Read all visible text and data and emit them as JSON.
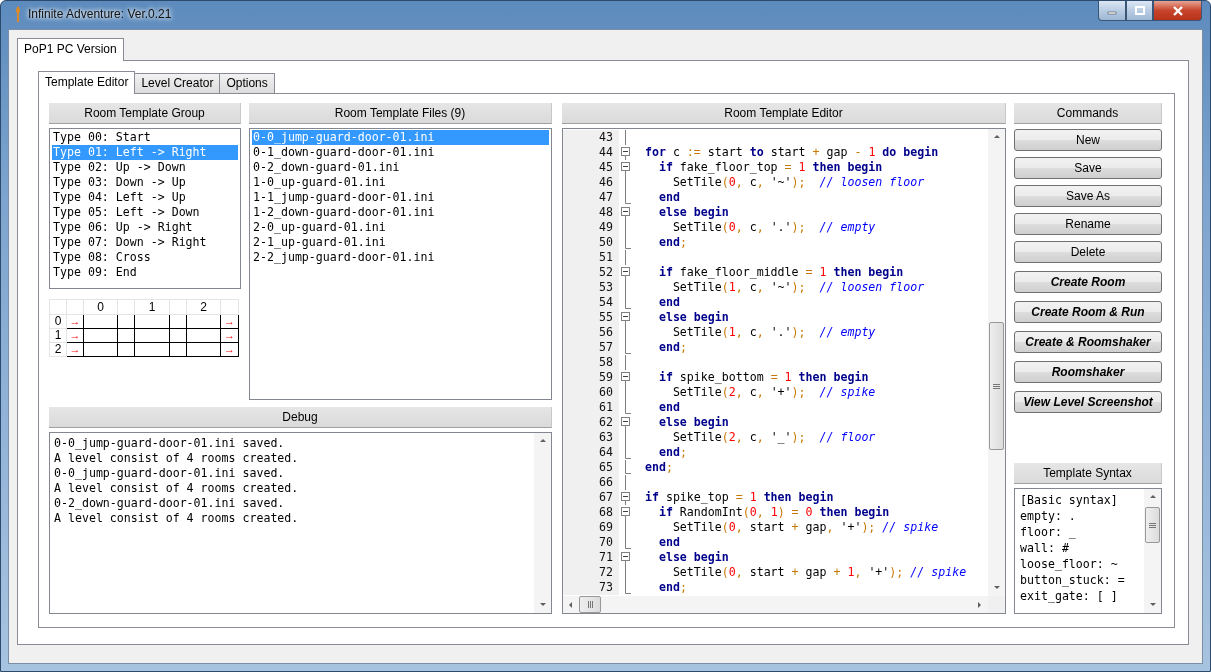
{
  "window": {
    "title": "Infinite Adventure: Ver.0.21"
  },
  "outer_tabs": [
    {
      "label": "PoP1 PC Version",
      "selected": true
    }
  ],
  "inner_tabs": [
    {
      "label": "Template Editor",
      "selected": true
    },
    {
      "label": "Level Creator",
      "selected": false
    },
    {
      "label": "Options",
      "selected": false
    }
  ],
  "room_template_group": {
    "title": "Room Template Group",
    "items": [
      {
        "label": "Type 00: Start",
        "selected": false
      },
      {
        "label": "Type 01: Left -> Right",
        "selected": true
      },
      {
        "label": "Type 02: Up -> Down",
        "selected": false
      },
      {
        "label": "Type 03: Down -> Up",
        "selected": false
      },
      {
        "label": "Type 04: Left -> Up",
        "selected": false
      },
      {
        "label": "Type 05: Left -> Down",
        "selected": false
      },
      {
        "label": "Type 06: Up -> Right",
        "selected": false
      },
      {
        "label": "Type 07: Down -> Right",
        "selected": false
      },
      {
        "label": "Type 08: Cross",
        "selected": false
      },
      {
        "label": "Type 09: End",
        "selected": false
      }
    ]
  },
  "room_grid": {
    "columns": [
      "0",
      "1",
      "2"
    ],
    "rows": [
      {
        "label": "0",
        "left": "→",
        "right": "→"
      },
      {
        "label": "1",
        "left": "→",
        "right": "→"
      },
      {
        "label": "2",
        "left": "→",
        "right": "→"
      }
    ]
  },
  "room_template_files": {
    "title": "Room Template Files (9)",
    "items": [
      {
        "label": "0-0_jump-guard-door-01.ini",
        "selected": true
      },
      {
        "label": "0-1_down-guard-door-01.ini",
        "selected": false
      },
      {
        "label": "0-2_down-guard-01.ini",
        "selected": false
      },
      {
        "label": "1-0_up-guard-01.ini",
        "selected": false
      },
      {
        "label": "1-1_jump-guard-door-01.ini",
        "selected": false
      },
      {
        "label": "1-2_down-guard-door-01.ini",
        "selected": false
      },
      {
        "label": "2-0_up-guard-01.ini",
        "selected": false
      },
      {
        "label": "2-1_up-guard-01.ini",
        "selected": false
      },
      {
        "label": "2-2_jump-guard-door-01.ini",
        "selected": false
      }
    ]
  },
  "debug": {
    "title": "Debug",
    "lines": [
      "0-0_jump-guard-door-01.ini saved.",
      "A level consist of 4 rooms created.",
      "0-0_jump-guard-door-01.ini saved.",
      "A level consist of 4 rooms created.",
      "0-2_down-guard-door-01.ini saved.",
      "A level consist of 4 rooms created."
    ]
  },
  "editor": {
    "title": "Room Template Editor",
    "lines": [
      {
        "number": "43",
        "kind": "line"
      },
      {
        "number": "44",
        "kind": "open",
        "tokens": [
          {
            "kind": "keyword",
            "text": "  for"
          },
          {
            "kind": "plain",
            "text": " c "
          },
          {
            "kind": "symbol",
            "text": ":="
          },
          {
            "kind": "plain",
            "text": " start "
          },
          {
            "kind": "keyword",
            "text": "to"
          },
          {
            "kind": "plain",
            "text": " start "
          },
          {
            "kind": "symbol",
            "text": "+"
          },
          {
            "kind": "plain",
            "text": " gap "
          },
          {
            "kind": "symbol",
            "text": "- "
          },
          {
            "kind": "number",
            "text": "1"
          },
          {
            "kind": "keyword",
            "text": " do begin"
          }
        ]
      },
      {
        "number": "45",
        "kind": "open",
        "tokens": [
          {
            "kind": "keyword",
            "text": "    if"
          },
          {
            "kind": "plain",
            "text": " fake_floor_top "
          },
          {
            "kind": "symbol",
            "text": "= "
          },
          {
            "kind": "number",
            "text": "1"
          },
          {
            "kind": "keyword",
            "text": " then begin"
          }
        ]
      },
      {
        "number": "46",
        "kind": "line",
        "tokens": [
          {
            "kind": "plain",
            "text": "      SetTile"
          },
          {
            "kind": "symbol",
            "text": "("
          },
          {
            "kind": "number",
            "text": "0"
          },
          {
            "kind": "symbol",
            "text": ","
          },
          {
            "kind": "plain",
            "text": " c"
          },
          {
            "kind": "symbol",
            "text": ","
          },
          {
            "kind": "plain",
            "text": " '~'"
          },
          {
            "kind": "symbol",
            "text": ");  "
          },
          {
            "kind": "comment",
            "text": "// loosen floor"
          }
        ]
      },
      {
        "number": "47",
        "kind": "end",
        "tokens": [
          {
            "kind": "keyword",
            "text": "    end"
          }
        ]
      },
      {
        "number": "48",
        "kind": "open",
        "tokens": [
          {
            "kind": "keyword",
            "text": "    else begin"
          }
        ]
      },
      {
        "number": "49",
        "kind": "line",
        "tokens": [
          {
            "kind": "plain",
            "text": "      SetTile"
          },
          {
            "kind": "symbol",
            "text": "("
          },
          {
            "kind": "number",
            "text": "0"
          },
          {
            "kind": "symbol",
            "text": ","
          },
          {
            "kind": "plain",
            "text": " c"
          },
          {
            "kind": "symbol",
            "text": ","
          },
          {
            "kind": "plain",
            "text": " '.'"
          },
          {
            "kind": "symbol",
            "text": ");  "
          },
          {
            "kind": "comment",
            "text": "// empty"
          }
        ]
      },
      {
        "number": "50",
        "kind": "end",
        "tokens": [
          {
            "kind": "keyword",
            "text": "    end"
          },
          {
            "kind": "symbol",
            "text": ";"
          }
        ]
      },
      {
        "number": "51",
        "kind": "line"
      },
      {
        "number": "52",
        "kind": "open",
        "tokens": [
          {
            "kind": "keyword",
            "text": "    if"
          },
          {
            "kind": "plain",
            "text": " fake_floor_middle "
          },
          {
            "kind": "symbol",
            "text": "= "
          },
          {
            "kind": "number",
            "text": "1"
          },
          {
            "kind": "keyword",
            "text": " then begin"
          }
        ]
      },
      {
        "number": "53",
        "kind": "line",
        "tokens": [
          {
            "kind": "plain",
            "text": "      SetTile"
          },
          {
            "kind": "symbol",
            "text": "("
          },
          {
            "kind": "number",
            "text": "1"
          },
          {
            "kind": "symbol",
            "text": ","
          },
          {
            "kind": "plain",
            "text": " c"
          },
          {
            "kind": "symbol",
            "text": ","
          },
          {
            "kind": "plain",
            "text": " '~'"
          },
          {
            "kind": "symbol",
            "text": ");  "
          },
          {
            "kind": "comment",
            "text": "// loosen floor"
          }
        ]
      },
      {
        "number": "54",
        "kind": "end",
        "tokens": [
          {
            "kind": "keyword",
            "text": "    end"
          }
        ]
      },
      {
        "number": "55",
        "kind": "open",
        "tokens": [
          {
            "kind": "keyword",
            "text": "    else begin"
          }
        ]
      },
      {
        "number": "56",
        "kind": "line",
        "tokens": [
          {
            "kind": "plain",
            "text": "      SetTile"
          },
          {
            "kind": "symbol",
            "text": "("
          },
          {
            "kind": "number",
            "text": "1"
          },
          {
            "kind": "symbol",
            "text": ","
          },
          {
            "kind": "plain",
            "text": " c"
          },
          {
            "kind": "symbol",
            "text": ","
          },
          {
            "kind": "plain",
            "text": " '.'"
          },
          {
            "kind": "symbol",
            "text": ");  "
          },
          {
            "kind": "comment",
            "text": "// empty"
          }
        ]
      },
      {
        "number": "57",
        "kind": "end",
        "tokens": [
          {
            "kind": "keyword",
            "text": "    end"
          },
          {
            "kind": "symbol",
            "text": ";"
          }
        ]
      },
      {
        "number": "58",
        "kind": "line"
      },
      {
        "number": "59",
        "kind": "open",
        "tokens": [
          {
            "kind": "keyword",
            "text": "    if"
          },
          {
            "kind": "plain",
            "text": " spike_bottom "
          },
          {
            "kind": "symbol",
            "text": "= "
          },
          {
            "kind": "number",
            "text": "1"
          },
          {
            "kind": "keyword",
            "text": " then begin"
          }
        ]
      },
      {
        "number": "60",
        "kind": "line",
        "tokens": [
          {
            "kind": "plain",
            "text": "      SetTile"
          },
          {
            "kind": "symbol",
            "text": "("
          },
          {
            "kind": "number",
            "text": "2"
          },
          {
            "kind": "symbol",
            "text": ","
          },
          {
            "kind": "plain",
            "text": " c"
          },
          {
            "kind": "symbol",
            "text": ","
          },
          {
            "kind": "plain",
            "text": " '+'"
          },
          {
            "kind": "symbol",
            "text": ");  "
          },
          {
            "kind": "comment",
            "text": "// spike"
          }
        ]
      },
      {
        "number": "61",
        "kind": "end",
        "tokens": [
          {
            "kind": "keyword",
            "text": "    end"
          }
        ]
      },
      {
        "number": "62",
        "kind": "open",
        "tokens": [
          {
            "kind": "keyword",
            "text": "    else begin"
          }
        ]
      },
      {
        "number": "63",
        "kind": "line",
        "tokens": [
          {
            "kind": "plain",
            "text": "      SetTile"
          },
          {
            "kind": "symbol",
            "text": "("
          },
          {
            "kind": "number",
            "text": "2"
          },
          {
            "kind": "symbol",
            "text": ","
          },
          {
            "kind": "plain",
            "text": " c"
          },
          {
            "kind": "symbol",
            "text": ","
          },
          {
            "kind": "plain",
            "text": " '_'"
          },
          {
            "kind": "symbol",
            "text": ");  "
          },
          {
            "kind": "comment",
            "text": "// floor"
          }
        ]
      },
      {
        "number": "64",
        "kind": "end",
        "tokens": [
          {
            "kind": "keyword",
            "text": "    end"
          },
          {
            "kind": "symbol",
            "text": ";"
          }
        ]
      },
      {
        "number": "65",
        "kind": "end",
        "tokens": [
          {
            "kind": "keyword",
            "text": "  end"
          },
          {
            "kind": "symbol",
            "text": ";"
          }
        ]
      },
      {
        "number": "66",
        "kind": "line"
      },
      {
        "number": "67",
        "kind": "open",
        "tokens": [
          {
            "kind": "keyword",
            "text": "  if"
          },
          {
            "kind": "plain",
            "text": " spike_top "
          },
          {
            "kind": "symbol",
            "text": "= "
          },
          {
            "kind": "number",
            "text": "1"
          },
          {
            "kind": "keyword",
            "text": " then begin"
          }
        ]
      },
      {
        "number": "68",
        "kind": "open",
        "tokens": [
          {
            "kind": "keyword",
            "text": "    if"
          },
          {
            "kind": "plain",
            "text": " RandomInt"
          },
          {
            "kind": "symbol",
            "text": "("
          },
          {
            "kind": "number",
            "text": "0"
          },
          {
            "kind": "symbol",
            "text": ", "
          },
          {
            "kind": "number",
            "text": "1"
          },
          {
            "kind": "symbol",
            "text": ") = "
          },
          {
            "kind": "number",
            "text": "0"
          },
          {
            "kind": "keyword",
            "text": " then begin"
          }
        ]
      },
      {
        "number": "69",
        "kind": "line",
        "tokens": [
          {
            "kind": "plain",
            "text": "      SetTile"
          },
          {
            "kind": "symbol",
            "text": "("
          },
          {
            "kind": "number",
            "text": "0"
          },
          {
            "kind": "symbol",
            "text": ","
          },
          {
            "kind": "plain",
            "text": " start "
          },
          {
            "kind": "symbol",
            "text": "+"
          },
          {
            "kind": "plain",
            "text": " gap"
          },
          {
            "kind": "symbol",
            "text": ","
          },
          {
            "kind": "plain",
            "text": " '+'"
          },
          {
            "kind": "symbol",
            "text": "); "
          },
          {
            "kind": "comment",
            "text": "// spike"
          }
        ]
      },
      {
        "number": "70",
        "kind": "end",
        "tokens": [
          {
            "kind": "keyword",
            "text": "    end"
          }
        ]
      },
      {
        "number": "71",
        "kind": "open",
        "tokens": [
          {
            "kind": "keyword",
            "text": "    else begin"
          }
        ]
      },
      {
        "number": "72",
        "kind": "line",
        "tokens": [
          {
            "kind": "plain",
            "text": "      SetTile"
          },
          {
            "kind": "symbol",
            "text": "("
          },
          {
            "kind": "number",
            "text": "0"
          },
          {
            "kind": "symbol",
            "text": ","
          },
          {
            "kind": "plain",
            "text": " start "
          },
          {
            "kind": "symbol",
            "text": "+"
          },
          {
            "kind": "plain",
            "text": " gap "
          },
          {
            "kind": "symbol",
            "text": "+ "
          },
          {
            "kind": "number",
            "text": "1"
          },
          {
            "kind": "symbol",
            "text": ","
          },
          {
            "kind": "plain",
            "text": " '+'"
          },
          {
            "kind": "symbol",
            "text": "); "
          },
          {
            "kind": "comment",
            "text": "// spike"
          }
        ]
      },
      {
        "number": "73",
        "kind": "end",
        "tokens": [
          {
            "kind": "keyword",
            "text": "    end"
          },
          {
            "kind": "symbol",
            "text": ";"
          }
        ]
      }
    ]
  },
  "commands": {
    "title": "Commands",
    "buttons": [
      {
        "label": "New",
        "kind": "plain"
      },
      {
        "label": "Save",
        "kind": "plain"
      },
      {
        "label": "Save As",
        "kind": "plain"
      },
      {
        "label": "Rename",
        "kind": "plain"
      },
      {
        "label": "Delete",
        "kind": "plain"
      },
      {
        "label": "Create Room",
        "kind": "bold"
      },
      {
        "label": "Create Room & Run",
        "kind": "bold"
      },
      {
        "label": "Create & Roomshaker",
        "kind": "bold"
      },
      {
        "label": "Roomshaker",
        "kind": "bold"
      },
      {
        "label": "View Level Screenshot",
        "kind": "bold"
      }
    ]
  },
  "template_syntax": {
    "title": "Template Syntax",
    "lines": [
      "[Basic syntax]",
      "empty: .",
      "floor: _",
      "wall: #",
      "loose_floor: ~",
      "button_stuck: =",
      "exit_gate: [ ]"
    ]
  }
}
